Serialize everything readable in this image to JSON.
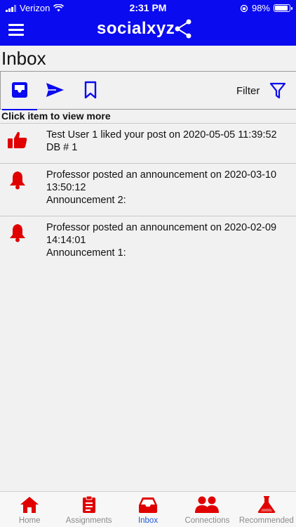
{
  "status_bar": {
    "carrier": "Verizon",
    "time": "2:31 PM",
    "battery": "98%"
  },
  "header": {
    "brand": "socialxyz"
  },
  "page": {
    "title": "Inbox",
    "hint": "Click item to view more"
  },
  "toolbar": {
    "filter_label": "Filter",
    "icons": [
      "inbox-icon",
      "send-icon",
      "bookmark-icon",
      "filter-icon"
    ]
  },
  "inbox": [
    {
      "icon": "thumbs-up-icon",
      "line1": "Test User 1 liked your post on 2020-05-05 11:39:52",
      "line2": "DB # 1",
      "line3": ""
    },
    {
      "icon": "bell-icon",
      "line1": "Professor posted an announcement on 2020-03-10",
      "line2": "13:50:12",
      "line3": "Announcement 2:"
    },
    {
      "icon": "bell-icon",
      "line1": "Professor posted an announcement on 2020-02-09",
      "line2": "14:14:01",
      "line3": "Announcement 1:"
    }
  ],
  "tabs": [
    {
      "label": "Home",
      "icon": "home-icon"
    },
    {
      "label": "Assignments",
      "icon": "clipboard-icon"
    },
    {
      "label": "Inbox",
      "icon": "inbox-tray-icon",
      "active": true
    },
    {
      "label": "Connections",
      "icon": "users-icon"
    },
    {
      "label": "Recommended",
      "icon": "flask-icon"
    }
  ],
  "colors": {
    "brand_blue": "#0b0bef",
    "accent_red": "#e00000",
    "active_tab": "#1e58d9"
  }
}
